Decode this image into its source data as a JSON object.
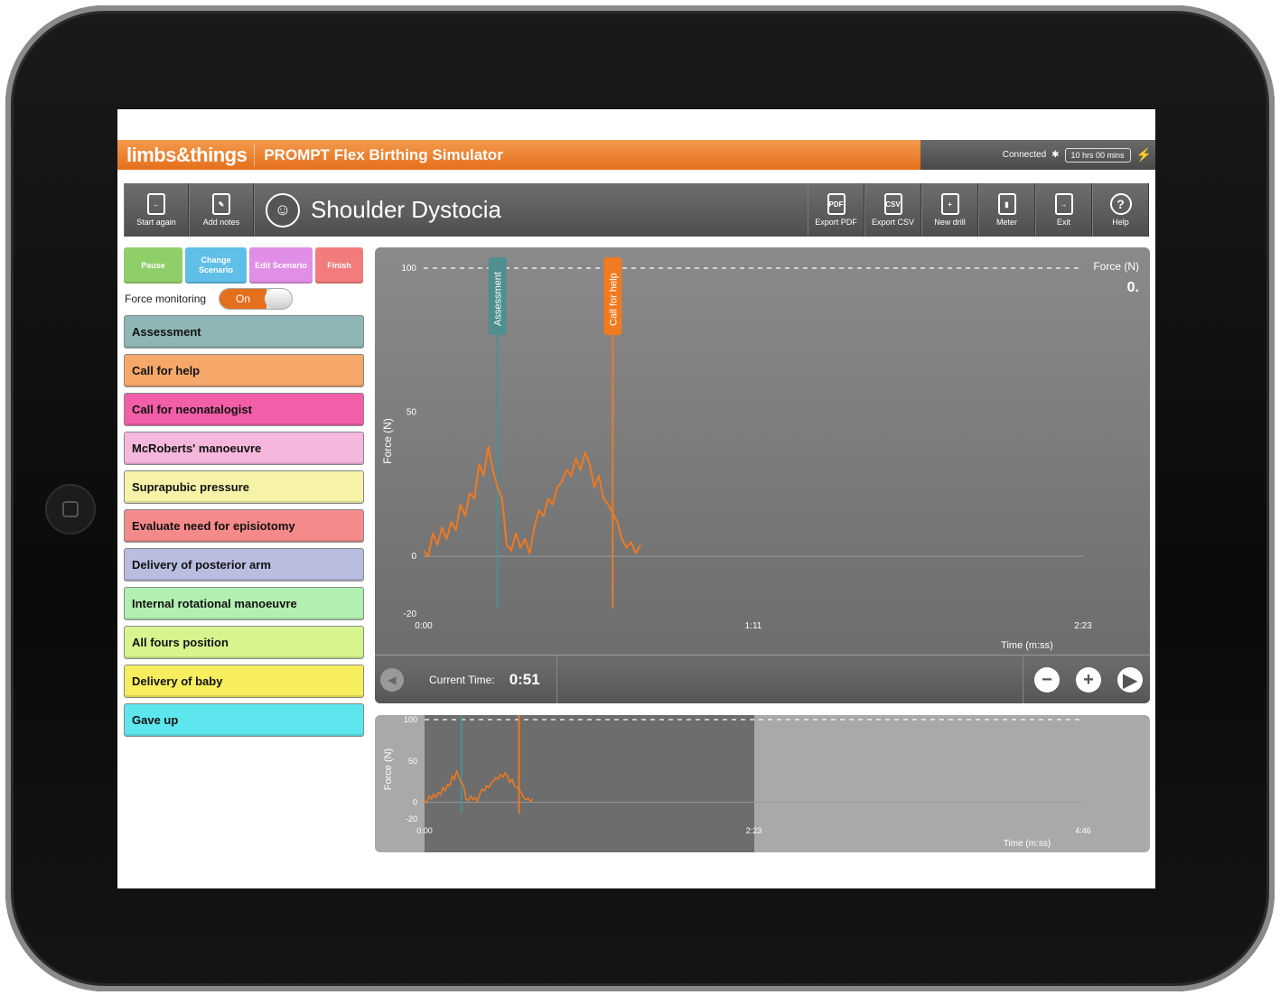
{
  "header": {
    "logo": "limbs&things",
    "app_title": "PROMPT Flex Birthing Simulator",
    "connection": "Connected",
    "battery": "10 hrs 00 mins"
  },
  "toolbar": {
    "start_again": "Start again",
    "add_notes": "Add notes",
    "scenario_title": "Shoulder Dystocia",
    "export_pdf": "Export PDF",
    "export_csv": "Export CSV",
    "new_drill": "New drill",
    "meter": "Meter",
    "exit": "Exit",
    "help": "Help",
    "pdf_tag": "PDF",
    "csv_tag": "CSV"
  },
  "controls": {
    "pause": "Pause",
    "change_scenario": "Change Scenario",
    "edit_scenario": "Edit Scenario",
    "finish": "Finish",
    "force_monitoring_label": "Force monitoring",
    "force_monitoring_state": "On"
  },
  "actions": [
    {
      "label": "Assessment",
      "color": "#8fb6b6"
    },
    {
      "label": "Call for help",
      "color": "#f6a86a"
    },
    {
      "label": "Call for neonatalogist",
      "color": "#f25fa8"
    },
    {
      "label": "McRoberts' manoeuvre",
      "color": "#f5b8dc"
    },
    {
      "label": "Suprapubic pressure",
      "color": "#f6f3a8"
    },
    {
      "label": "Evaluate need for episiotomy",
      "color": "#f48a8a"
    },
    {
      "label": "Delivery of posterior arm",
      "color": "#b9bde0"
    },
    {
      "label": "Internal rotational manoeuvre",
      "color": "#b2f0b2"
    },
    {
      "label": "All fours position",
      "color": "#d6f58e"
    },
    {
      "label": "Delivery of baby",
      "color": "#f7ee5e"
    },
    {
      "label": "Gave up",
      "color": "#5ee6ee"
    }
  ],
  "chart": {
    "force_label": "Force (N)",
    "force_value": "0.",
    "current_time_label": "Current Time:",
    "current_time": "0:51"
  },
  "chart_data": [
    {
      "type": "line",
      "ylabel": "Force (N)",
      "xlabel": "Time (m:ss)",
      "ylim": [
        -20,
        100
      ],
      "x_ticks": [
        "0:00",
        "1:11",
        "2:23"
      ],
      "y_ticks": [
        "100",
        "50",
        "0",
        "-20"
      ],
      "threshold": 100,
      "markers": [
        {
          "label": "Assessment",
          "t": 16,
          "color": "#4f8f8f"
        },
        {
          "label": "Call for help",
          "t": 41,
          "color": "#f07a1f"
        }
      ],
      "series": [
        {
          "color": "#f07a1f",
          "x": [
            0,
            1,
            2,
            3,
            4,
            5,
            6,
            7,
            8,
            9,
            10,
            11,
            12,
            13,
            14,
            15,
            16,
            17,
            18,
            19,
            20,
            21,
            22,
            23,
            24,
            25,
            26,
            27,
            28,
            29,
            30,
            31,
            32,
            33,
            34,
            35,
            36,
            37,
            38,
            39,
            40,
            41,
            42,
            43,
            44,
            45,
            46,
            47
          ],
          "y": [
            2,
            0,
            8,
            4,
            10,
            6,
            12,
            9,
            18,
            14,
            22,
            20,
            32,
            28,
            38,
            30,
            24,
            20,
            4,
            2,
            8,
            3,
            6,
            1,
            10,
            16,
            14,
            20,
            18,
            24,
            26,
            30,
            28,
            34,
            30,
            36,
            32,
            24,
            28,
            20,
            18,
            15,
            12,
            6,
            3,
            5,
            1,
            4
          ]
        }
      ]
    },
    {
      "type": "line",
      "ylabel": "Force (N)",
      "xlabel": "Time (m:ss)",
      "ylim": [
        -20,
        100
      ],
      "x_ticks": [
        "0:00",
        "2:23",
        "4:46"
      ],
      "y_ticks": [
        "100",
        "50",
        "0",
        "-20"
      ],
      "markers": [
        {
          "label": "Assessment",
          "t": 16,
          "color": "#4f8f8f"
        },
        {
          "label": "Call for help",
          "t": 41,
          "color": "#f07a1f"
        }
      ],
      "series": [
        {
          "color": "#f07a1f",
          "x": [
            0,
            1,
            2,
            3,
            4,
            5,
            6,
            7,
            8,
            9,
            10,
            11,
            12,
            13,
            14,
            15,
            16,
            17,
            18,
            19,
            20,
            21,
            22,
            23,
            24,
            25,
            26,
            27,
            28,
            29,
            30,
            31,
            32,
            33,
            34,
            35,
            36,
            37,
            38,
            39,
            40,
            41,
            42,
            43,
            44,
            45,
            46,
            47
          ],
          "y": [
            2,
            0,
            8,
            4,
            10,
            6,
            12,
            9,
            18,
            14,
            22,
            20,
            32,
            28,
            38,
            30,
            24,
            20,
            4,
            2,
            8,
            3,
            6,
            1,
            10,
            16,
            14,
            20,
            18,
            24,
            26,
            30,
            28,
            34,
            30,
            36,
            32,
            24,
            28,
            20,
            18,
            15,
            12,
            6,
            3,
            5,
            1,
            4
          ]
        }
      ]
    }
  ],
  "colors": {
    "brand_orange": "#e46f1c",
    "toolbar_gray": "#5a5a5a"
  }
}
